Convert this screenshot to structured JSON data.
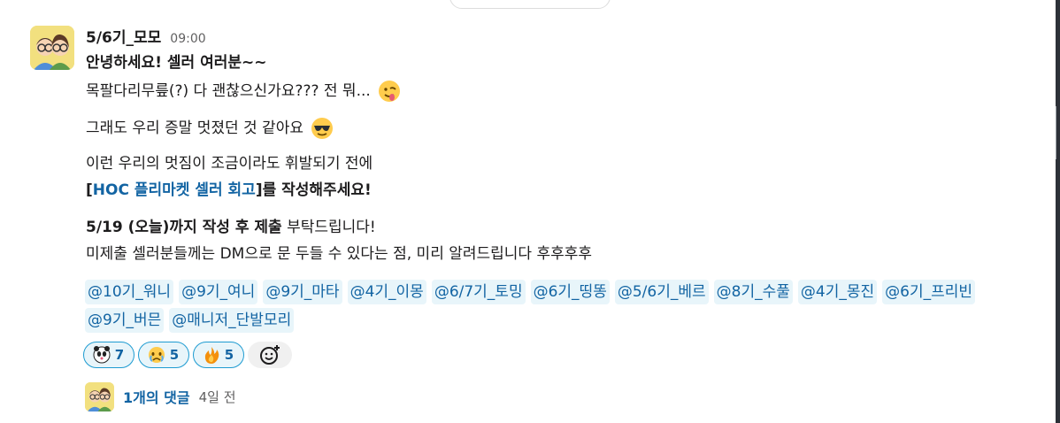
{
  "message": {
    "username": "5/6기_모모",
    "time": "09:00",
    "lines": {
      "l1": "안녕하세요! 셀러 여러분~~",
      "l2": "목팔다리무릎(?) 다 괜찮으신가요??? 전 뭐...",
      "l3": "그래도 우리 증말 멋졌던 것 같아요",
      "l4": "이런 우리의 멋짐이 조금이라도 휘발되기 전에",
      "l5_open": "[",
      "l5_link": "HOC 플리마켓 셀러 회고",
      "l5_close": "]를 작성해주세요!",
      "l6_bold": "5/19 (오늘)까지 작성 후 제출",
      "l6_rest": " 부탁드립니다!",
      "l7": "미제출 셀러분들께는 DM으로 문 두들 수 있다는 점, 미리 알려드립니다 후후후후"
    },
    "emojis": {
      "l2": "face-with-tongue-emoji",
      "l3": "sunglasses-face-emoji"
    }
  },
  "mentions": [
    "@10기_워니",
    "@9기_여니",
    "@9기_마타",
    "@4기_이몽",
    "@6/7기_토밍",
    "@6기_띵똥",
    "@5/6기_베르",
    "@8기_수풀",
    "@4기_몽진",
    "@6기_프리빈",
    "@9기_버믄",
    "@매니저_단발모리"
  ],
  "reactions": [
    {
      "icon": "custom-panda-emoji",
      "count": "7"
    },
    {
      "icon": "crying-face-emoji",
      "count": "5"
    },
    {
      "icon": "fire-emoji",
      "count": "5"
    }
  ],
  "thread": {
    "replies": "1개의 댓글",
    "ago": "4일 전"
  },
  "colors": {
    "link": "#1264a3",
    "mention_bg": "#e8f5fa",
    "reaction_border": "#1d9bd1",
    "text": "#1d1c1d",
    "muted": "#616061"
  }
}
